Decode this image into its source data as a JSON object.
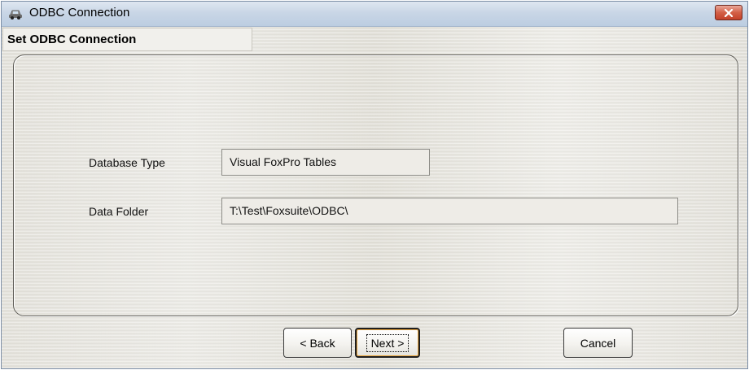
{
  "window": {
    "title": "ODBC Connection",
    "app_icon": "odbc-car-icon",
    "close_icon": "close-icon"
  },
  "section": {
    "title": "Set ODBC Connection"
  },
  "fields": {
    "database_type": {
      "label": "Database Type",
      "value": "Visual FoxPro Tables"
    },
    "data_folder": {
      "label": "Data Folder",
      "value": "T:\\Test\\Foxsuite\\ODBC\\"
    }
  },
  "buttons": {
    "back": "< Back",
    "next": "Next >",
    "cancel": "Cancel"
  },
  "colors": {
    "close_button": "#c3412a",
    "titlebar": "#c9d6e6"
  }
}
